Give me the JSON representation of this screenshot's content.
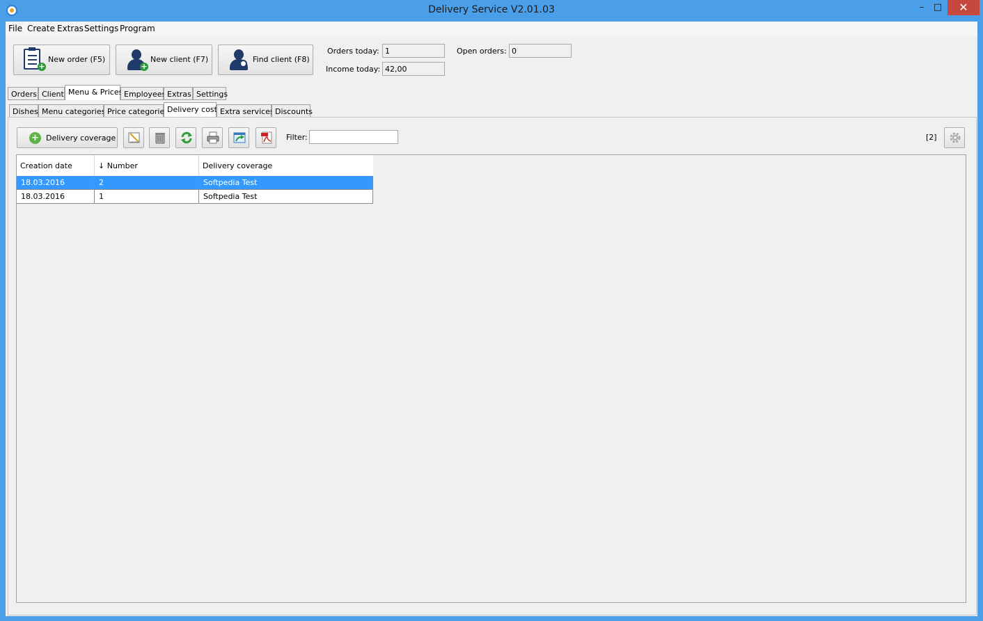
{
  "window": {
    "title": "Delivery Service V2.01.03",
    "controls": {
      "minimize": "–",
      "maximize": "□",
      "close": "✕"
    }
  },
  "menubar": [
    "File",
    "Create",
    "Extras",
    "Settings",
    "Program"
  ],
  "toolbar": {
    "new_order": "New order (F5)",
    "new_client": "New client (F7)",
    "find_client": "Find client (F8)"
  },
  "stats": {
    "orders_today_label": "Orders today:",
    "orders_today_value": "1",
    "income_today_label": "Income today:",
    "income_today_value": "42,00",
    "open_orders_label": "Open orders:",
    "open_orders_value": "0"
  },
  "main_tabs": [
    "Orders",
    "Client",
    "Menu & Prices",
    "Employees",
    "Extras",
    "Settings"
  ],
  "main_tab_active": "Menu & Prices",
  "sub_tabs": [
    "Dishes",
    "Menu categories",
    "Price categories",
    "Delivery costs",
    "Extra services",
    "Discounts"
  ],
  "sub_tab_active": "Delivery costs",
  "action_bar": {
    "add_button": "Delivery coverage",
    "filter_label": "Filter:",
    "filter_value": "",
    "count": "[2]",
    "icons": [
      "edit-icon",
      "trash-icon",
      "refresh-icon",
      "print-icon",
      "export-icon",
      "pdf-icon",
      "gear-icon"
    ]
  },
  "table": {
    "columns": [
      "Creation date",
      "↓ Number",
      "Delivery coverage"
    ],
    "rows": [
      {
        "date": "18.03.2016",
        "number": "2",
        "coverage": "Softpedia Test",
        "selected": true
      },
      {
        "date": "18.03.2016",
        "number": "1",
        "coverage": "Softpedia Test",
        "selected": false
      }
    ]
  }
}
